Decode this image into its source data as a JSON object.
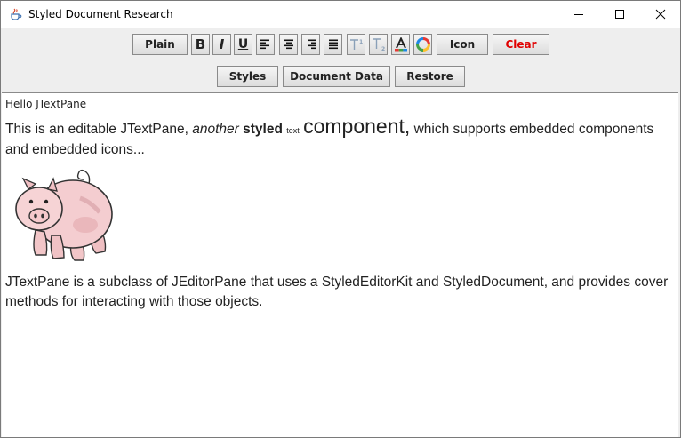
{
  "window": {
    "title": "Styled Document Research"
  },
  "toolbar": {
    "plain_label": "Plain",
    "bold_label": "B",
    "italic_label": "I",
    "underline_label": "U",
    "icon_label": "Icon",
    "clear_label": "Clear",
    "clear_color": "#e00000",
    "styles_label": "Styles",
    "document_data_label": "Document Data",
    "restore_label": "Restore"
  },
  "editor": {
    "line1": "Hello JTextPane",
    "para1": {
      "seg1": "This is an editable JTextPane, ",
      "seg2": "another",
      "seg3": "styled",
      "seg4": "text",
      "seg5": "component,",
      "seg6": " which supports embedded components and embedded icons..."
    },
    "image_icon": "pig-icon",
    "para2": "JTextPane is a subclass of JEditorPane that uses a StyledEditorKit and StyledDocument, and provides cover methods for interacting with those objects."
  }
}
